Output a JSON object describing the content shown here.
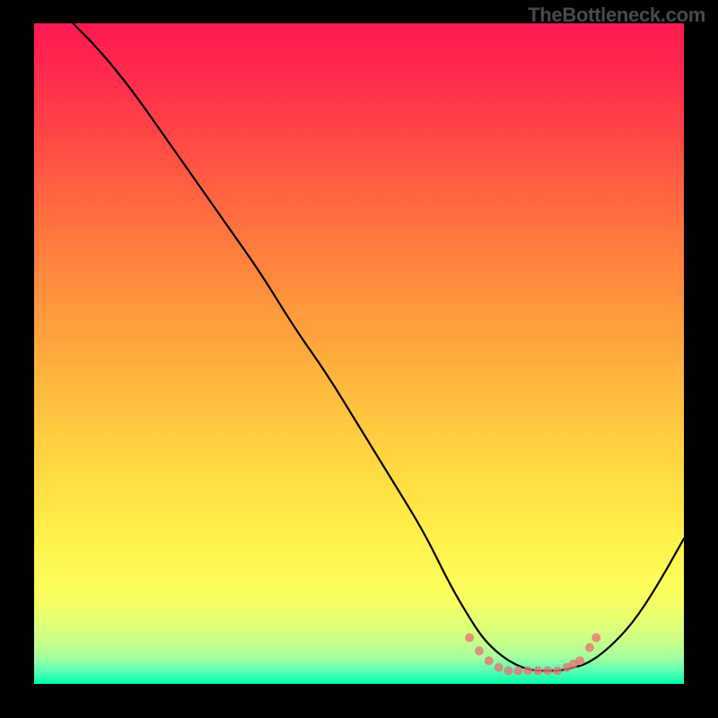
{
  "watermark": "TheBottleneck.com",
  "colors": {
    "gradient_top": "#ff1a52",
    "gradient_bottom": "#00ffa8",
    "curve": "#000000",
    "dots": "#e57373",
    "frame": "#000000"
  },
  "chart_data": {
    "type": "line",
    "title": "",
    "xlabel": "",
    "ylabel": "",
    "xlim": [
      0,
      100
    ],
    "ylim": [
      0,
      100
    ],
    "grid": false,
    "legend": false,
    "background_gradient": {
      "top_value": 100,
      "bottom_value": 0,
      "top_color": "#ff1a52",
      "bottom_color": "#00ffa8"
    },
    "series": [
      {
        "name": "bottleneck-curve",
        "x": [
          6,
          10,
          15,
          20,
          25,
          30,
          35,
          40,
          45,
          50,
          55,
          60,
          64,
          67,
          69,
          71,
          73,
          75,
          77,
          79,
          81,
          83,
          85,
          88,
          92,
          96,
          100
        ],
        "y": [
          100,
          96,
          90,
          83,
          76,
          69,
          62,
          54,
          47,
          39,
          31,
          23,
          15,
          10,
          7,
          5,
          3.5,
          2.5,
          2,
          2,
          2,
          2.5,
          3,
          5,
          9,
          15,
          22
        ]
      }
    ],
    "highlight_points": {
      "name": "optimal-range-dots",
      "color": "#e57373",
      "points": [
        {
          "x": 67,
          "y": 7
        },
        {
          "x": 68.5,
          "y": 5
        },
        {
          "x": 70,
          "y": 3.5
        },
        {
          "x": 71.5,
          "y": 2.5
        },
        {
          "x": 73,
          "y": 2
        },
        {
          "x": 74.5,
          "y": 2
        },
        {
          "x": 76,
          "y": 2
        },
        {
          "x": 77.5,
          "y": 2
        },
        {
          "x": 79,
          "y": 2
        },
        {
          "x": 80.5,
          "y": 2
        },
        {
          "x": 82,
          "y": 2.5
        },
        {
          "x": 83,
          "y": 3
        },
        {
          "x": 84,
          "y": 3.5
        },
        {
          "x": 85.5,
          "y": 5.5
        },
        {
          "x": 86.5,
          "y": 7
        }
      ]
    }
  }
}
